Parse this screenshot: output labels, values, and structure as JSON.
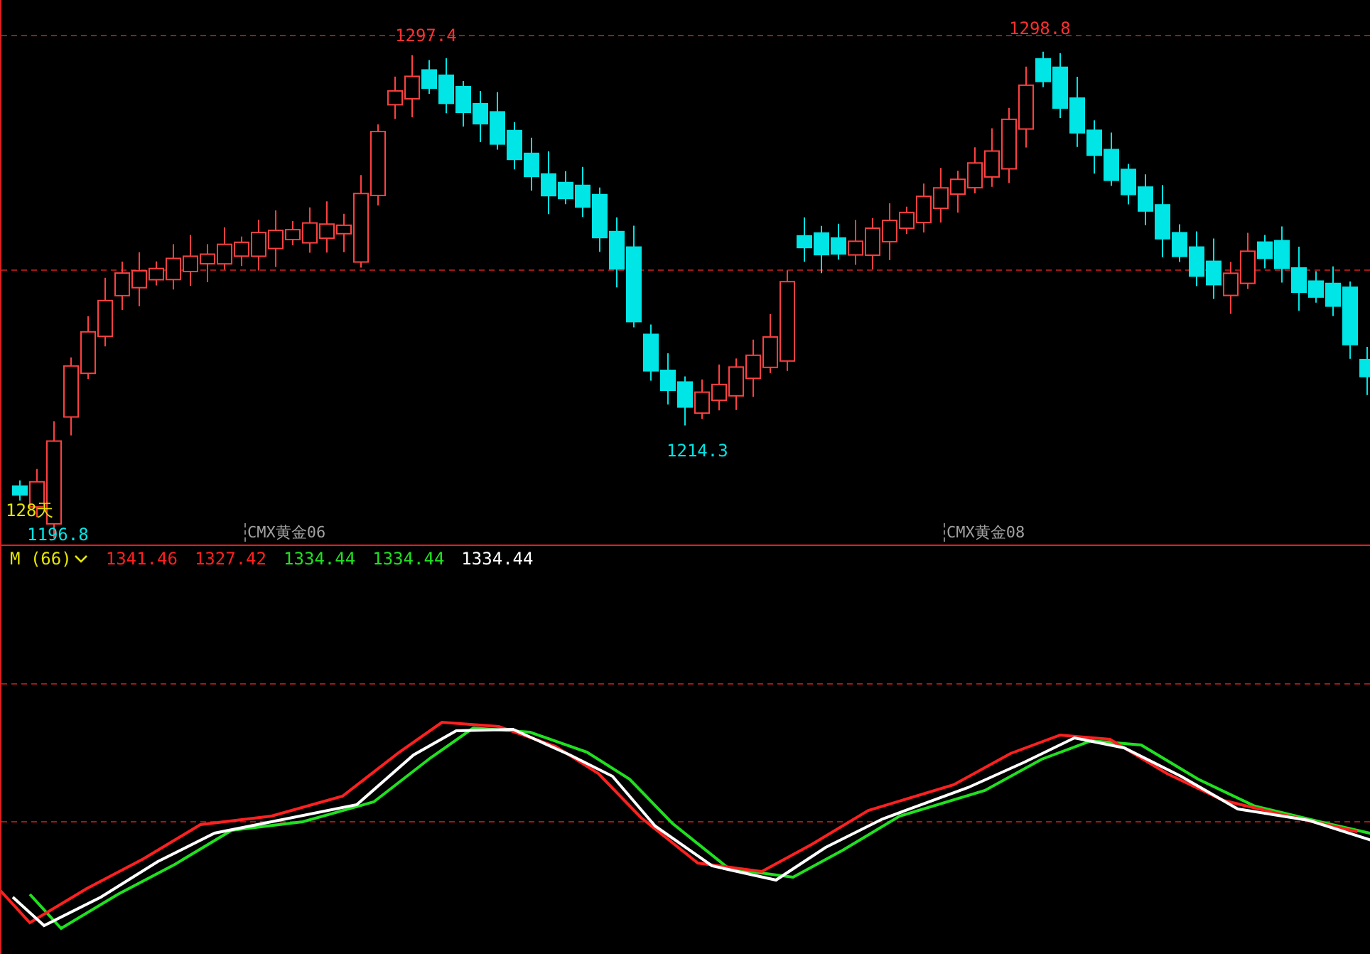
{
  "price_chart": {
    "price_marks": [
      {
        "text": "1297.4",
        "color": "#ff3030"
      },
      {
        "text": "1298.8",
        "color": "#ff3030"
      },
      {
        "text": "1214.3",
        "color": "#00e5e5"
      },
      {
        "text": "128天",
        "color": "#e5e500"
      },
      {
        "text": "1196.8",
        "color": "#00e5e5"
      }
    ],
    "contract_labels": [
      "CMX黄金06",
      "CMX黄金08"
    ]
  },
  "indicator": {
    "name": "M (66)",
    "values": [
      {
        "text": "1341.46",
        "color": "#ff2020"
      },
      {
        "text": "1327.42",
        "color": "#ff2020"
      },
      {
        "text": "1334.44",
        "color": "#20e020"
      },
      {
        "text": "1334.44",
        "color": "#20e020"
      },
      {
        "text": "1334.44",
        "color": "#ffffff"
      }
    ]
  }
}
